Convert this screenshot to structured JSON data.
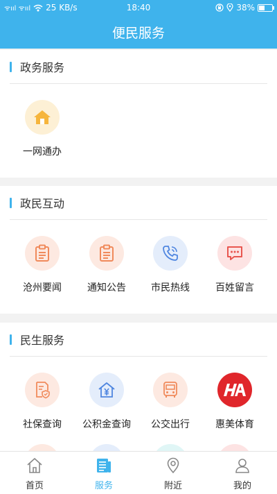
{
  "status": {
    "signal": "ᯤııl ᯤııl",
    "speed": "25 KB/s",
    "time": "18:40",
    "battery": "38%"
  },
  "header": {
    "title": "便民服务"
  },
  "sections": [
    {
      "title": "政务服务",
      "items": [
        {
          "label": "一网通办",
          "icon": "home-icon",
          "bg": "#fdf0d5",
          "color": "#f6b53c"
        }
      ]
    },
    {
      "title": "政民互动",
      "items": [
        {
          "label": "沧州要闻",
          "icon": "clipboard-icon",
          "bg": "#fde9e1",
          "color": "#f08a5b"
        },
        {
          "label": "通知公告",
          "icon": "clipboard-icon",
          "bg": "#fde9e1",
          "color": "#f08a5b"
        },
        {
          "label": "市民热线",
          "icon": "phone-icon",
          "bg": "#e4edfb",
          "color": "#4f86e0"
        },
        {
          "label": "百姓留言",
          "icon": "chat-icon",
          "bg": "#fde3e3",
          "color": "#e8564f"
        }
      ]
    },
    {
      "title": "民生服务",
      "items": [
        {
          "label": "社保查询",
          "icon": "document-shield-icon",
          "bg": "#fde9e1",
          "color": "#f08a5b"
        },
        {
          "label": "公积金查询",
          "icon": "house-yen-icon",
          "bg": "#e4edfb",
          "color": "#4f86e0"
        },
        {
          "label": "公交出行",
          "icon": "bus-icon",
          "bg": "#fde9e1",
          "color": "#f08a5b"
        },
        {
          "label": "惠美体育",
          "icon": "huimei-logo",
          "bg": "#e0262b",
          "color": "#ffffff",
          "logo_text": "H"
        }
      ]
    }
  ],
  "tabs": [
    {
      "label": "首页",
      "icon": "home-outline-icon",
      "active": false
    },
    {
      "label": "服务",
      "icon": "news-icon",
      "active": true
    },
    {
      "label": "附近",
      "icon": "location-icon",
      "active": false
    },
    {
      "label": "我的",
      "icon": "user-icon",
      "active": false
    }
  ],
  "colors": {
    "primary": "#3fb3ec",
    "background": "#f2f2f2"
  }
}
